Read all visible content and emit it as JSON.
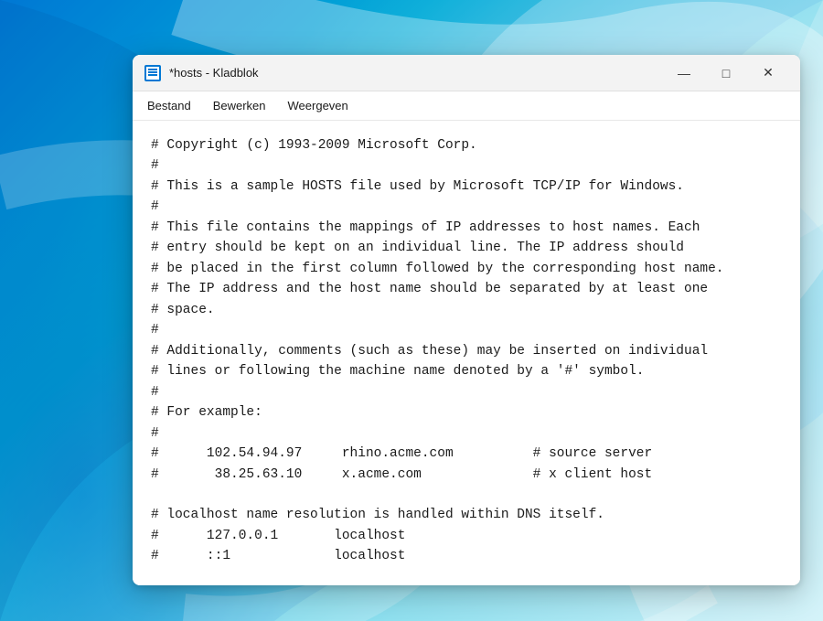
{
  "desktop": {
    "bg_description": "Windows 11 blue swirl wallpaper"
  },
  "window": {
    "title": "*hosts - Kladblok",
    "icon_label": "notepad-icon"
  },
  "title_bar_controls": {
    "minimize_label": "—",
    "maximize_label": "□",
    "close_label": "✕"
  },
  "menu": {
    "items": [
      {
        "label": "Bestand"
      },
      {
        "label": "Bewerken"
      },
      {
        "label": "Weergeven"
      }
    ]
  },
  "editor": {
    "content_lines": [
      "# Copyright (c) 1993-2009 Microsoft Corp.",
      "#",
      "# This is a sample HOSTS file used by Microsoft TCP/IP for Windows.",
      "#",
      "# This file contains the mappings of IP addresses to host names. Each",
      "# entry should be kept on an individual line. The IP address should",
      "# be placed in the first column followed by the corresponding host name.",
      "# The IP address and the host name should be separated by at least one",
      "# space.",
      "#",
      "# Additionally, comments (such as these) may be inserted on individual",
      "# lines or following the machine name denoted by a '#' symbol.",
      "#",
      "# For example:",
      "#",
      "#      102.54.94.97     rhino.acme.com          # source server",
      "#       38.25.63.10     x.acme.com              # x client host",
      "",
      "# localhost name resolution is handled within DNS itself.",
      "#      127.0.0.1       localhost",
      "#      ::1             localhost"
    ]
  }
}
